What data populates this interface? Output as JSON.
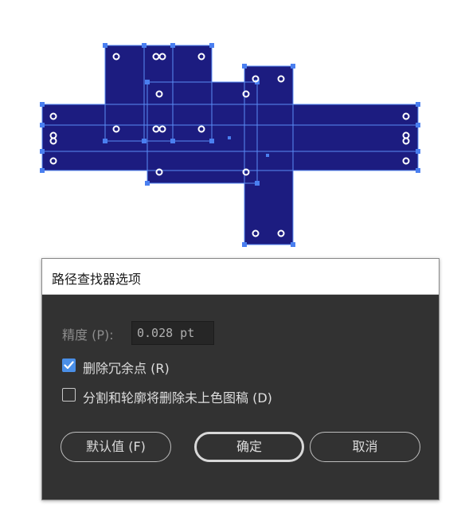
{
  "dialog": {
    "title": "路径查找器选项",
    "precision_label": "精度 (P):",
    "precision_value": "0.028 pt",
    "remove_redundant": {
      "label": "删除冗余点 (R)",
      "checked": true
    },
    "divide_outline": {
      "label": "分割和轮廓将删除未上色图稿 (D)",
      "checked": false
    },
    "buttons": {
      "defaults": "默认值 (F)",
      "ok": "确定",
      "cancel": "取消"
    }
  },
  "colors": {
    "shape_fill": "#1c1c80",
    "selection": "#4a7ff0",
    "checkbox_accent": "#4a8fe8",
    "dialog_bg": "#323232"
  }
}
